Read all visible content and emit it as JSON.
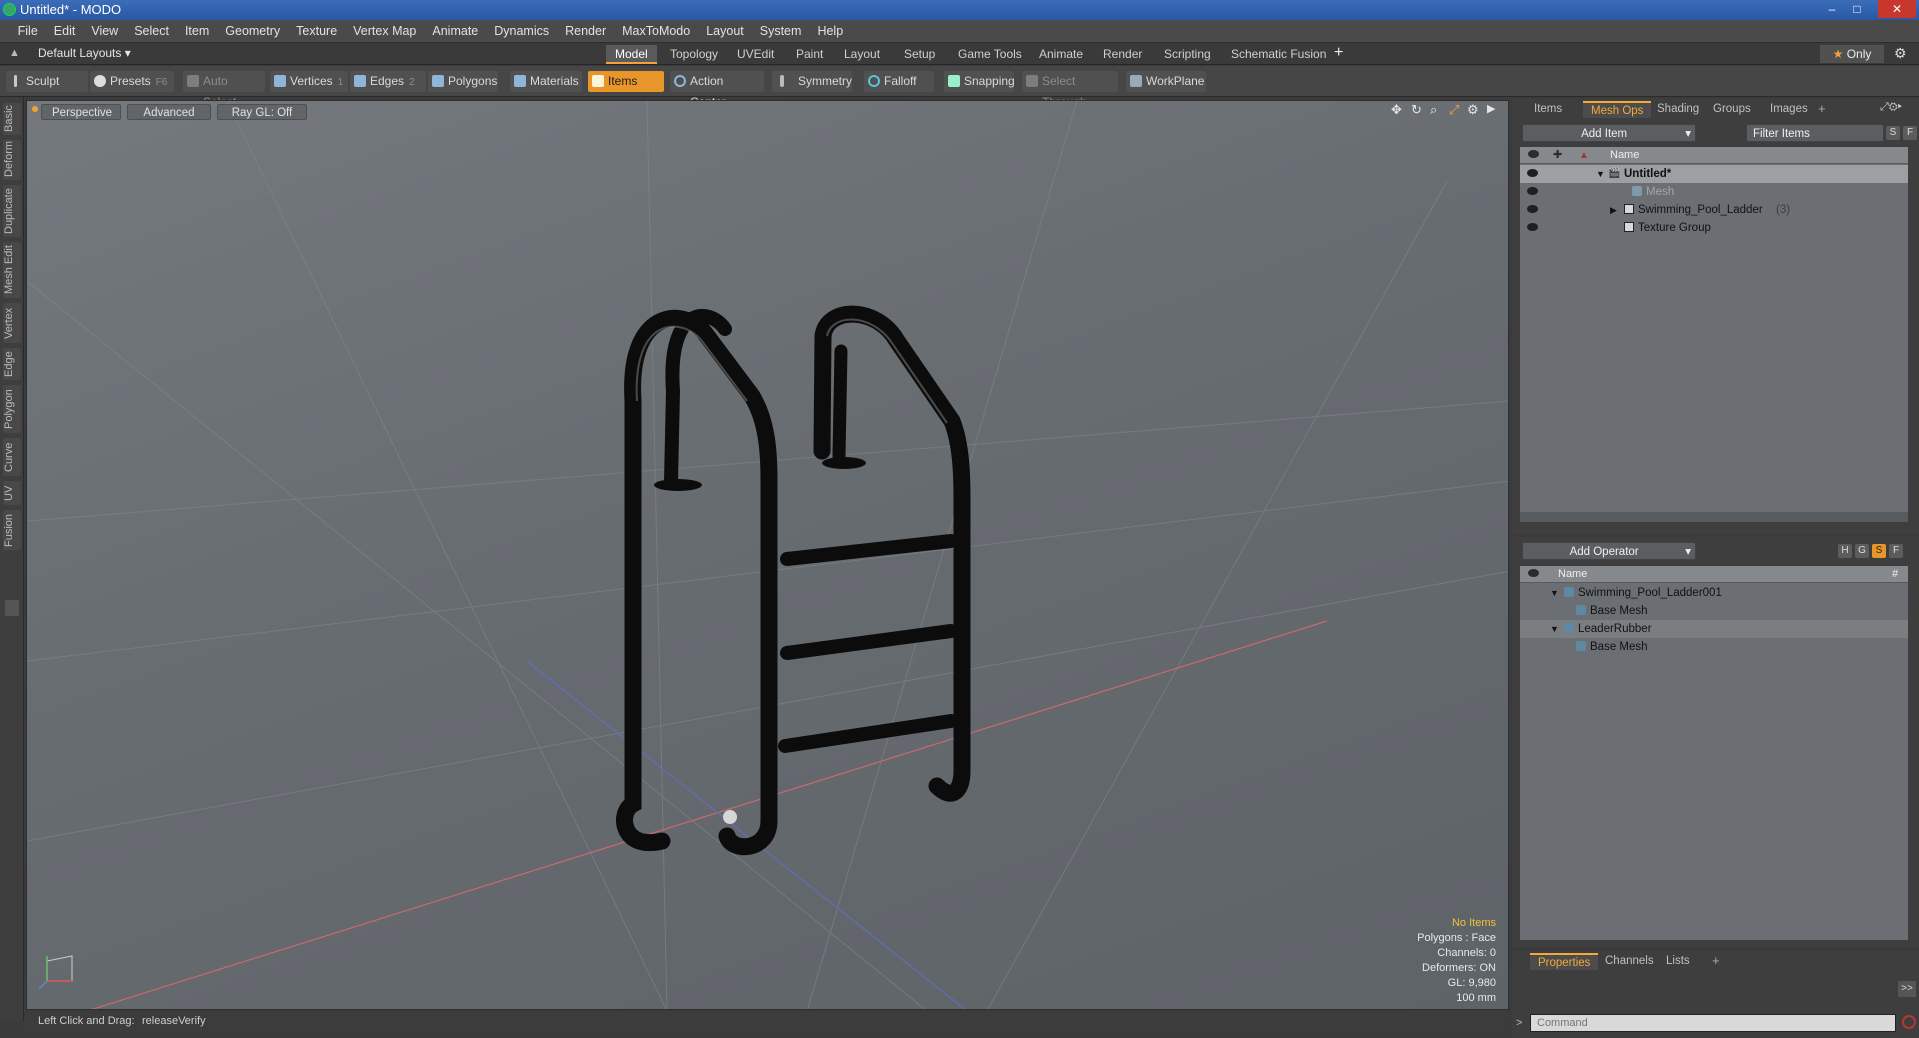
{
  "window": {
    "title": "Untitled* - MODO",
    "min": "–",
    "max": "□",
    "close": "✕"
  },
  "menu": [
    "File",
    "Edit",
    "View",
    "Select",
    "Item",
    "Geometry",
    "Texture",
    "Vertex Map",
    "Animate",
    "Dynamics",
    "Render",
    "MaxToModo",
    "Layout",
    "System",
    "Help"
  ],
  "layouts": {
    "label": "Default Layouts"
  },
  "tabs": [
    "Model",
    "Topology",
    "UVEdit",
    "Paint",
    "Layout",
    "Setup",
    "Game Tools",
    "Animate",
    "Render",
    "Scripting",
    "Schematic Fusion"
  ],
  "tabs_add": "+",
  "only_label": "Only",
  "toolbar": {
    "sculpt": "Sculpt",
    "presets": "Presets",
    "presets_key": "F6",
    "auto_select": "Auto Select",
    "vertices": "Vertices",
    "vertices_key": "1",
    "edges": "Edges",
    "edges_key": "2",
    "polygons": "Polygons",
    "materials": "Materials",
    "items": "Items",
    "action_center": "Action Center",
    "symmetry": "Symmetry",
    "falloff": "Falloff",
    "snapping": "Snapping",
    "select_through": "Select Through",
    "workplane": "WorkPlane"
  },
  "left_tabs": [
    "Basic",
    "Deform",
    "Duplicate",
    "Mesh Edit",
    "Vertex",
    "Edge",
    "Polygon",
    "Curve",
    "UV",
    "Fusion"
  ],
  "viewport": {
    "perspective": "Perspective",
    "advanced": "Advanced",
    "raygl": "Ray GL: Off",
    "info": {
      "selection": "No Items",
      "polygons": "Polygons : Face",
      "channels": "Channels: 0",
      "deformers": "Deformers: ON",
      "gl": "GL: 9,980",
      "unit": "100 mm"
    }
  },
  "status": {
    "action": "Left Click and Drag:",
    "command": "releaseVerify"
  },
  "items_panel": {
    "tabs": [
      "Items",
      "Mesh Ops",
      "Shading",
      "Groups",
      "Images"
    ],
    "active_tab": 1,
    "add_item": "Add Item",
    "filter": "Filter Items",
    "s": "S",
    "f": "F",
    "col_name": "Name",
    "rows": [
      {
        "label": "Untitled*"
      },
      {
        "label": "Mesh"
      },
      {
        "label": "Swimming_Pool_Ladder",
        "count": "(3)"
      },
      {
        "label": "Texture Group"
      }
    ]
  },
  "meshops_panel": {
    "add_operator": "Add Operator",
    "h": "H",
    "g": "G",
    "s": "S",
    "f": "F",
    "col_name": "Name",
    "col_hash": "#",
    "rows": [
      {
        "label": "Swimming_Pool_Ladder001"
      },
      {
        "label": "Base Mesh"
      },
      {
        "label": "LeaderRubber"
      },
      {
        "label": "Base Mesh"
      }
    ]
  },
  "props_panel": {
    "tabs": [
      "Properties",
      "Channels",
      "Lists"
    ],
    "expand": ">>",
    "command_placeholder": "Command"
  },
  "colors": {
    "accent": "#f1a23b",
    "viewport": "#6b7075",
    "ladder": "#0c0c0c"
  }
}
